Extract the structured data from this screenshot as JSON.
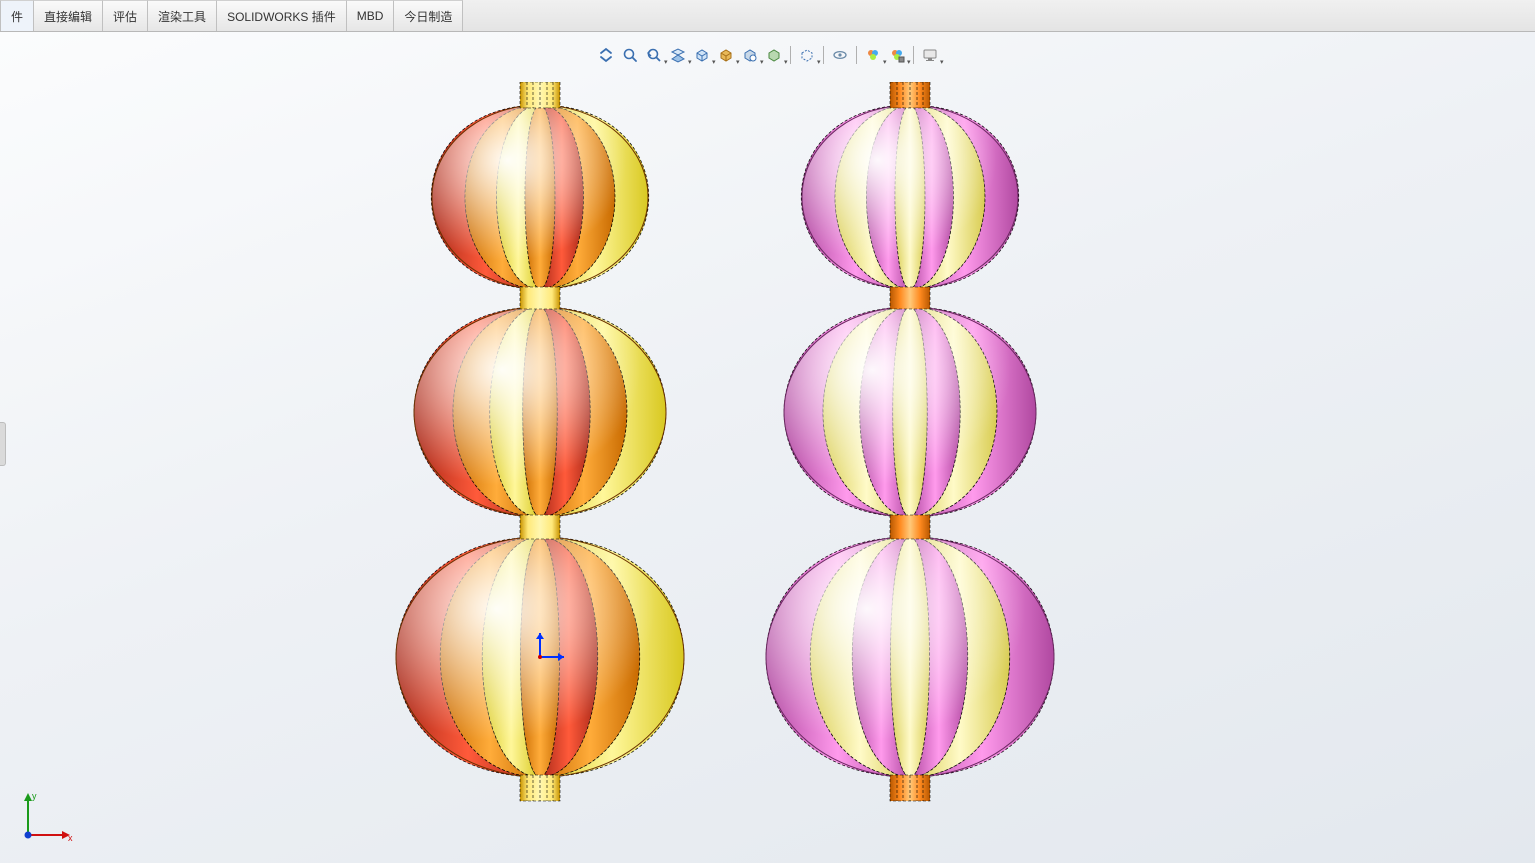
{
  "tabs": {
    "t0": "件",
    "t1": "直接编辑",
    "t2": "评估",
    "t3": "渲染工具",
    "t4": "SOLIDWORKS 插件",
    "t5": "MBD",
    "t6": "今日制造"
  },
  "hud": {
    "zoom_fit": "zoom-to-fit",
    "zoom_area": "zoom-to-area",
    "prev_view": "previous-view",
    "section": "section-view",
    "orient": "view-orientation",
    "style": "display-style",
    "hide_show": "hide-show-items",
    "edit_appearance": "edit-appearance",
    "apply_scene": "apply-scene",
    "view_settings": "view-settings"
  },
  "axes": {
    "x": "x",
    "y": "y"
  },
  "model": {
    "left": {
      "palette": [
        "#e34a2e",
        "#ff8a1f",
        "#fff36a",
        "#ff8a1f",
        "#e34a2e",
        "#ff8a1f",
        "#fff36a"
      ],
      "stem_colors": [
        "#ffe97a",
        "#ffb13a"
      ]
    },
    "right": {
      "palette": [
        "#e67ad8",
        "#fff7a8",
        "#e67ad8",
        "#fff7a8",
        "#e67ad8",
        "#fff7a8",
        "#e67ad8"
      ],
      "stem_colors": [
        "#ff8a1f",
        "#ffe97a"
      ]
    }
  }
}
